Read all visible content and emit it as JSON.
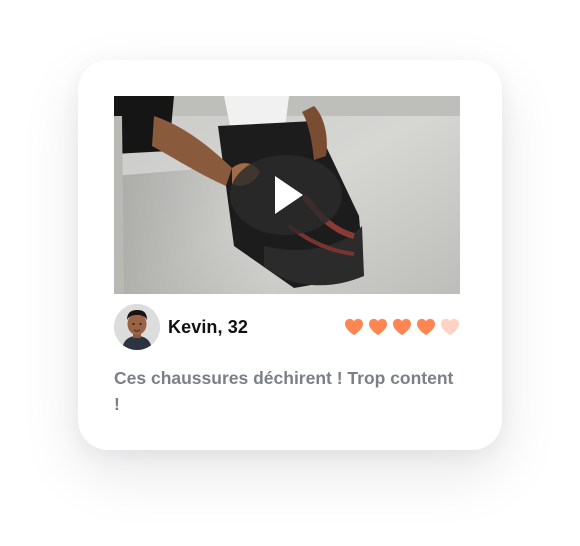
{
  "review": {
    "reviewer_name": "Kevin, 32",
    "text": "Ces chaussures déchirent ! Trop content !",
    "rating": {
      "value": 4,
      "max": 5
    }
  },
  "video": {
    "play_icon": "play-icon"
  },
  "colors": {
    "heart_filled": "#ff8552",
    "heart_empty": "#ffd2c2",
    "text_muted": "#7c7f86",
    "name": "#111111",
    "card_bg": "#ffffff"
  }
}
